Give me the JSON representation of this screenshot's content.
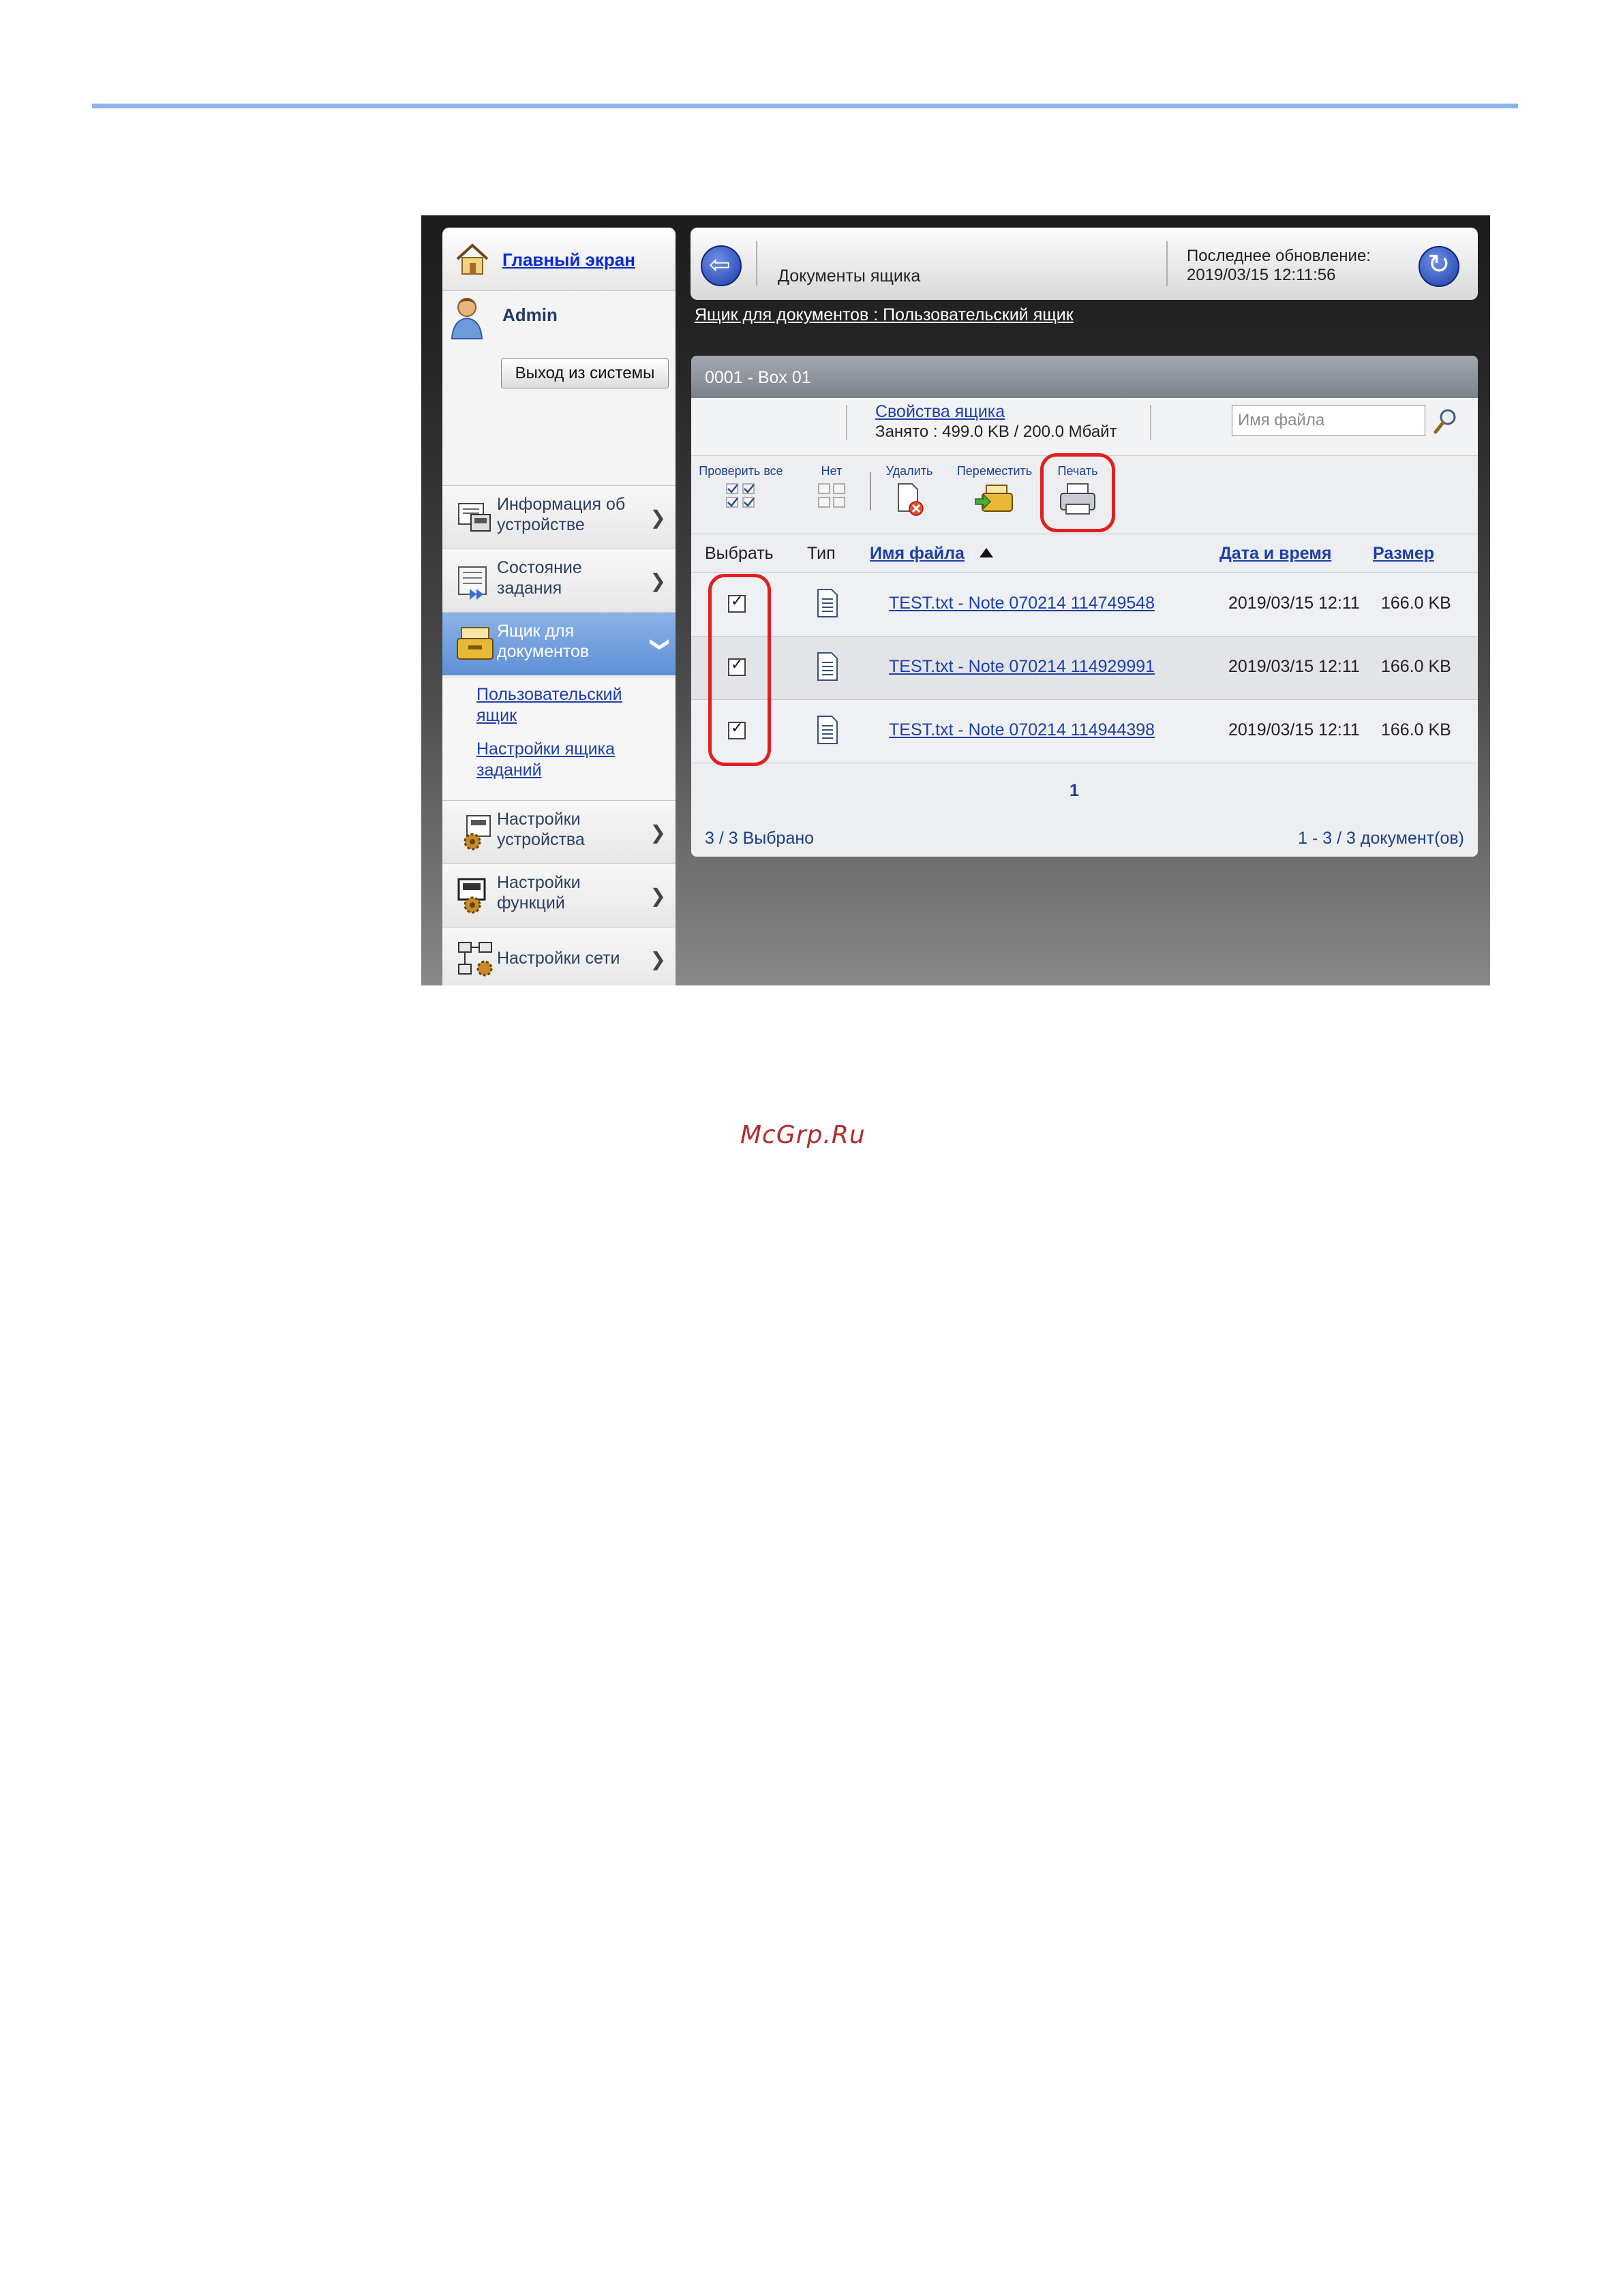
{
  "sidebar": {
    "home_link": "Главный экран",
    "user_name": "Admin",
    "logout_label": "Выход из системы",
    "items": [
      {
        "label": "Информация об устройстве"
      },
      {
        "label": "Состояние задания"
      },
      {
        "label": "Ящик для документов"
      },
      {
        "label": "Настройки устройства"
      },
      {
        "label": "Настройки функций"
      },
      {
        "label": "Настройки сети"
      }
    ],
    "subitems": [
      {
        "label": "Пользовательский ящик"
      },
      {
        "label": "Настройки ящика заданий"
      }
    ]
  },
  "header": {
    "title": "Документы ящика",
    "last_update_label": "Последнее обновление:",
    "last_update_value": "2019/03/15 12:11:56",
    "breadcrumb": "Ящик для документов : Пользовательский ящик"
  },
  "box": {
    "title": "0001 - Box 01",
    "properties_link": "Свойства ящика",
    "usage": "Занято : 499.0 KB / 200.0 Мбайт",
    "search_placeholder": "Имя файла"
  },
  "toolbar": {
    "select_all": "Проверить все",
    "none": "Нет",
    "delete": "Удалить",
    "move": "Переместить",
    "print": "Печать"
  },
  "table": {
    "headers": {
      "select": "Выбрать",
      "type": "Тип",
      "name": "Имя файла",
      "date": "Дата и время",
      "size": "Размер"
    },
    "rows": [
      {
        "name": "TEST.txt - Note 070214 114749548",
        "date": "2019/03/15 12:11",
        "size": "166.0 KB",
        "checked": true
      },
      {
        "name": "TEST.txt - Note 070214 114929991",
        "date": "2019/03/15 12:11",
        "size": "166.0 KB",
        "checked": true
      },
      {
        "name": "TEST.txt - Note 070214 114944398",
        "date": "2019/03/15 12:11",
        "size": "166.0 KB",
        "checked": true
      }
    ]
  },
  "pagination": {
    "current_page": "1"
  },
  "footer": {
    "selected": "3 / 3 Выбрано",
    "range": "1 - 3 / 3 документ(ов)"
  },
  "watermark": "McGrp.Ru",
  "colors": {
    "accent": "#5e8fd6",
    "link": "#1d3fa8",
    "highlight": "#e02020",
    "top_rule": "#8cb4ea"
  }
}
